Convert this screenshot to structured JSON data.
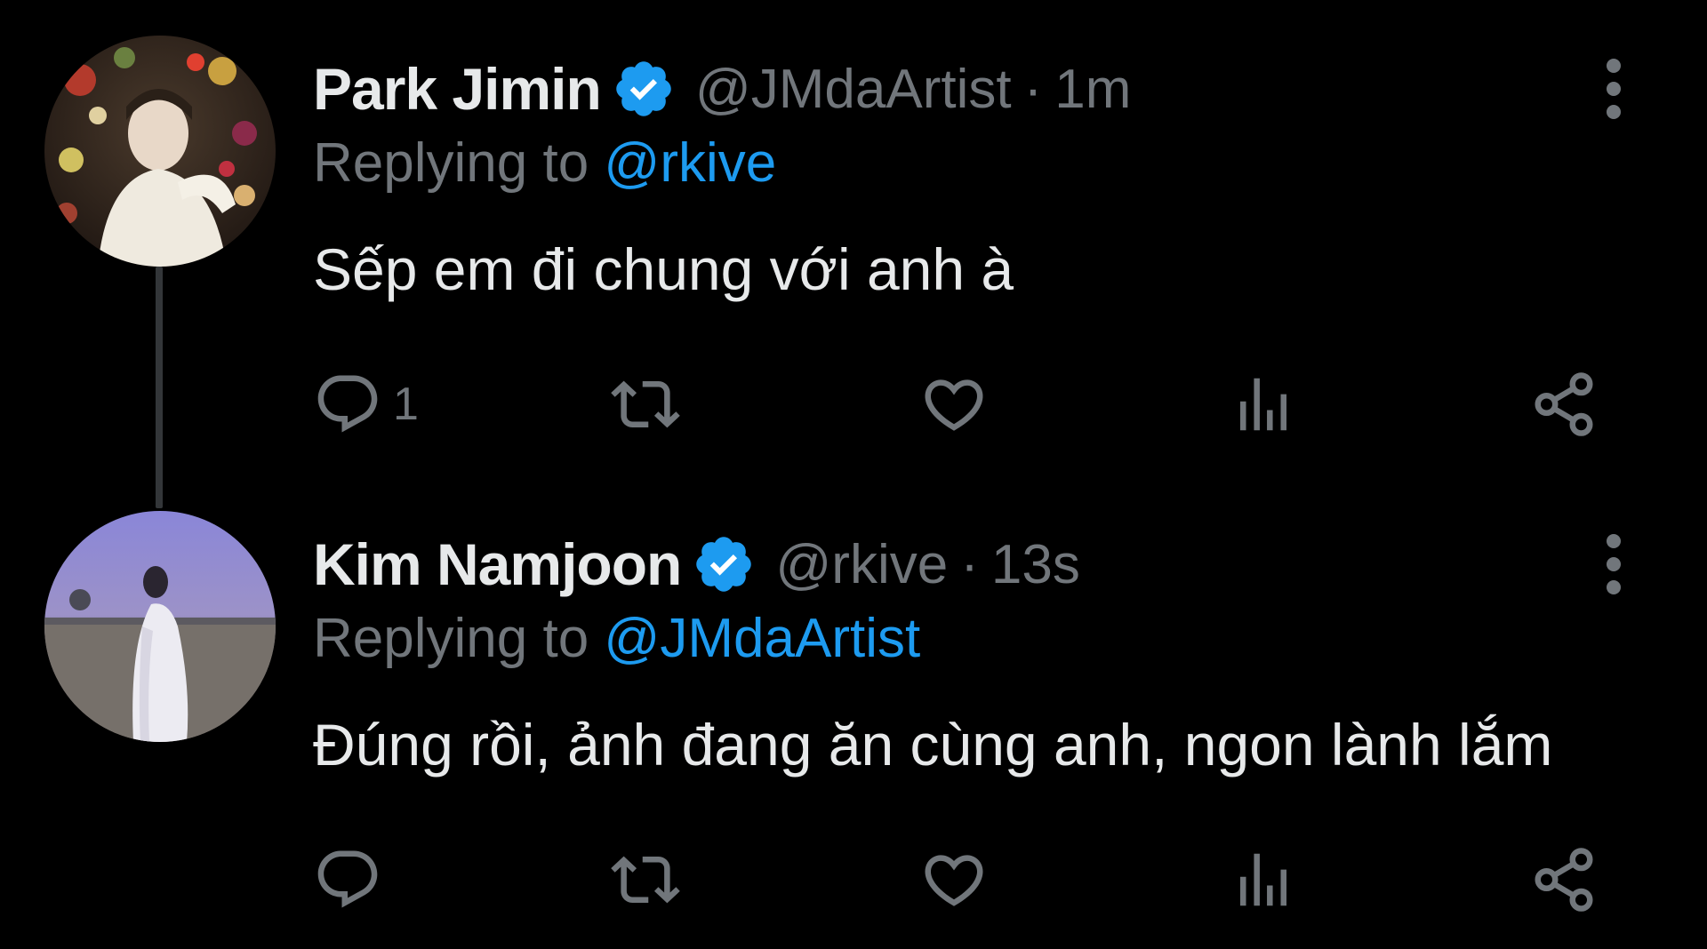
{
  "tweets": [
    {
      "display_name": "Park Jimin",
      "verified": true,
      "handle": "@JMdaArtist",
      "separator": "·",
      "time": "1m",
      "replying_prefix": "Replying to",
      "replying_to": "@rkive",
      "text": "Sếp em đi chung với anh à",
      "reply_count": "1",
      "avatar_icon": "avatar-photo-flowers"
    },
    {
      "display_name": "Kim Namjoon",
      "verified": true,
      "handle": "@rkive",
      "separator": "·",
      "time": "13s",
      "replying_prefix": "Replying to",
      "replying_to": "@JMdaArtist",
      "text": "Đúng rồi, ảnh đang ăn cùng anh, ngon lành lắm",
      "reply_count": "",
      "avatar_icon": "avatar-photo-field"
    }
  ],
  "icons": {
    "reply": "reply-icon",
    "retweet": "retweet-icon",
    "like": "heart-icon",
    "views": "views-icon",
    "share": "share-icon",
    "more": "more-vertical-icon",
    "verified": "verified-badge-icon"
  },
  "colors": {
    "background": "#000000",
    "primary_text": "#e7e9ea",
    "secondary_text": "#71767b",
    "accent": "#1d9bf0",
    "thread_line": "#333639"
  }
}
